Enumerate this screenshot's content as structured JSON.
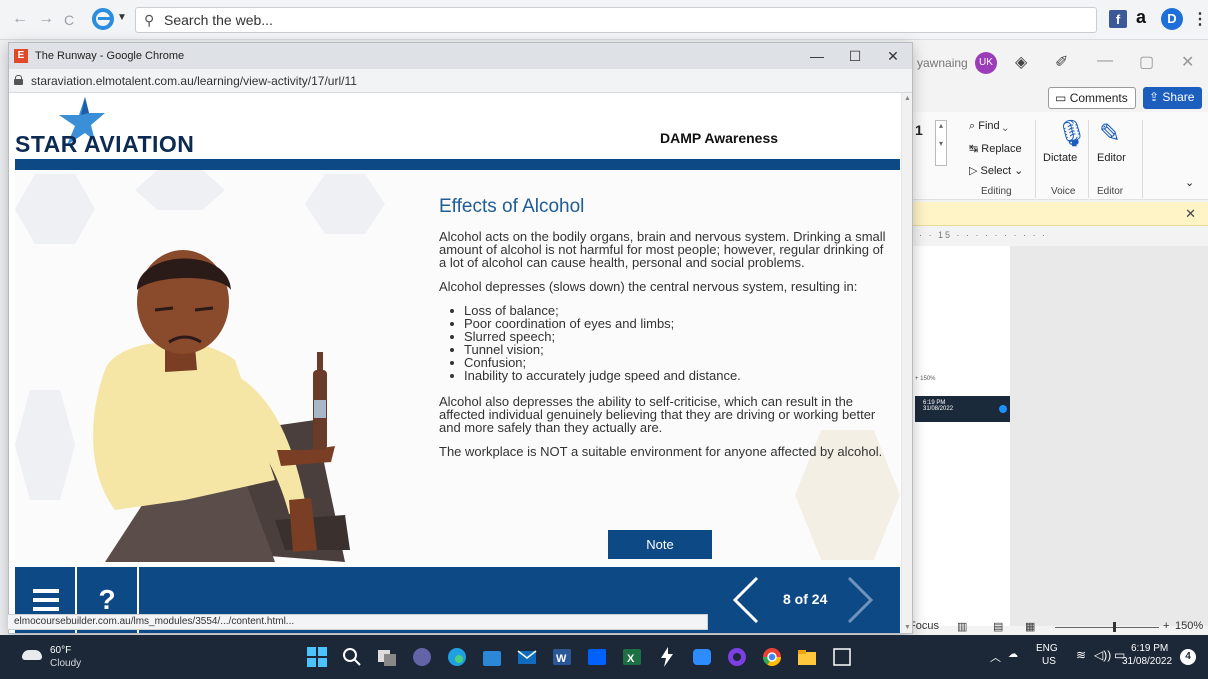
{
  "browser_toolbar": {
    "back_glyph": "←",
    "forward_glyph": "→",
    "reload_glyph": "C",
    "search_placeholder": "Search the web...",
    "fb_label": "f",
    "amazon_label": "a",
    "d_label": "D",
    "more_glyph": "⋮"
  },
  "word": {
    "username": "yawnaing",
    "avatar_initials": "UK",
    "comments_label": "Comments",
    "share_label": "Share",
    "font_size_value": "1",
    "find_label": "Find",
    "replace_label": "Replace",
    "select_label": "Select",
    "dictate_label": "Dictate",
    "editor_label": "Editor",
    "group_editing": "Editing",
    "group_voice": "Voice",
    "group_editor": "Editor",
    "ruler_text": "· · 15 · · · · · · · · · ·",
    "mini_zoom": "+ 150%",
    "mini_time": "6:19 PM",
    "mini_date": "31/08/2022",
    "focus_label": "Focus",
    "zoom_label": "150%"
  },
  "chrome": {
    "window_title": "The Runway - Google Chrome",
    "favicon_letter": "E",
    "url": "staraviation.elmotalent.com.au/learning/view-activity/17/url/11",
    "minimize_glyph": "—",
    "maximize_glyph": "☐",
    "close_glyph": "✕",
    "status_url": "elmocoursebuilder.com.au/lms_modules/3554/.../content.html..."
  },
  "course": {
    "logo_text": "STAR AVIATION",
    "title": "DAMP Awareness",
    "heading": "Effects of Alcohol",
    "para1": "Alcohol acts on the bodily organs, brain and nervous system. Drinking a small amount of alcohol is not harmful for most people; however, regular drinking of a lot of alcohol can cause health, personal and social problems.",
    "para2": "Alcohol depresses (slows down) the central nervous system, resulting in:",
    "effects": [
      "Loss of balance;",
      "Poor coordination of eyes and limbs;",
      "Slurred speech;",
      "Tunnel vision;",
      "Confusion;",
      "Inability to accurately judge speed and distance."
    ],
    "para3": "Alcohol also depresses the ability to self-criticise, which can result in the affected individual genuinely believing that they are driving or working better and more safely than they actually are.",
    "para4": "The workplace is NOT a suitable environment for anyone affected by alcohol.",
    "note_label": "Note",
    "help_label": "?",
    "pager": "8 of 24"
  },
  "taskbar": {
    "temperature": "60°F",
    "condition": "Cloudy",
    "lang_top": "ENG",
    "lang_bottom": "US",
    "time": "6:19 PM",
    "date": "31/08/2022",
    "notifications": "4"
  },
  "colors": {
    "brand_navy": "#0d4a85",
    "heading_blue": "#1f5d96",
    "taskbar": "#1c2737"
  }
}
